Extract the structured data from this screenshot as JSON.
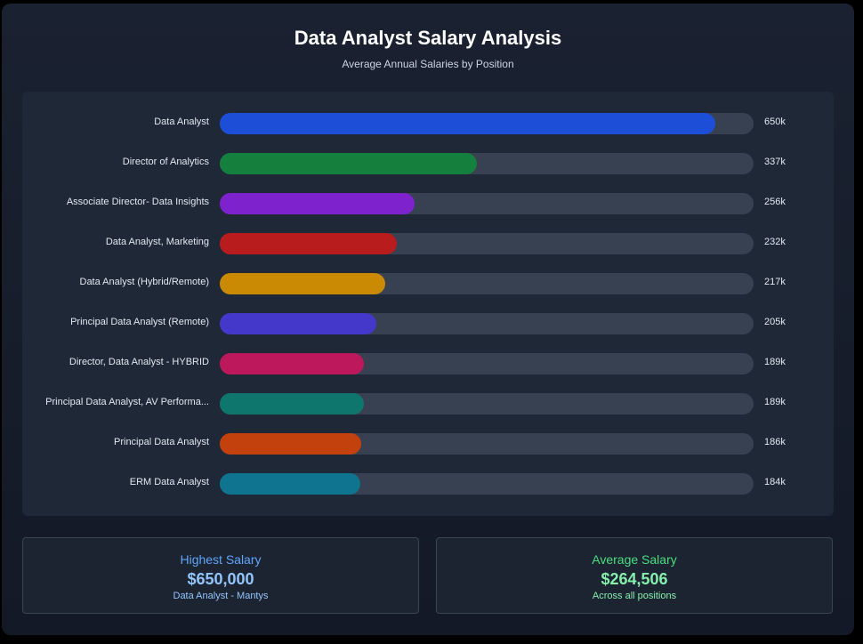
{
  "header": {
    "title": "Data Analyst Salary Analysis",
    "subtitle": "Average Annual Salaries by Position"
  },
  "chart_data": {
    "type": "bar",
    "orientation": "horizontal",
    "xlim": [
      0,
      700000
    ],
    "categories": [
      "Data Analyst",
      "Director of Analytics",
      "Associate Director- Data Insights",
      "Data Analyst, Marketing",
      "Data Analyst (Hybrid/Remote)",
      "Principal Data Analyst (Remote)",
      "Director, Data Analyst - HYBRID",
      "Principal Data Analyst, AV Performa...",
      "Principal Data Analyst",
      "ERM Data Analyst"
    ],
    "values": [
      650000,
      337000,
      256000,
      232000,
      217000,
      205000,
      189000,
      189000,
      186000,
      184000
    ],
    "value_labels": [
      "650k",
      "337k",
      "256k",
      "232k",
      "217k",
      "205k",
      "189k",
      "189k",
      "186k",
      "184k"
    ],
    "colors": [
      "#1d4ed8",
      "#15803d",
      "#7e22ce",
      "#b91c1c",
      "#ca8a04",
      "#4338ca",
      "#be185d",
      "#0f766e",
      "#c2410c",
      "#0e7490"
    ],
    "track_color": "#374151"
  },
  "summary": {
    "highest": {
      "title": "Highest Salary",
      "value": "$650,000",
      "note": "Data Analyst - Mantys",
      "title_color": "#60a5fa",
      "value_color": "#93c5fd",
      "note_color": "#93c5fd"
    },
    "average": {
      "title": "Average Salary",
      "value": "$264,506",
      "note": "Across all positions",
      "title_color": "#4ade80",
      "value_color": "#86efac",
      "note_color": "#86efac"
    }
  }
}
